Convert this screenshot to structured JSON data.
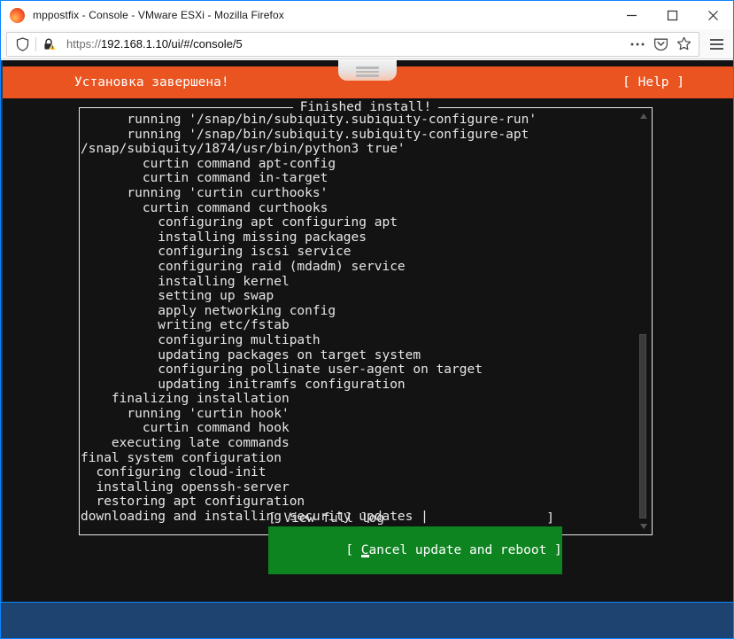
{
  "browser": {
    "window_title": "mppostfix - Console - VMware ESXi - Mozilla Firefox",
    "minimize_label": "Minimize",
    "maximize_label": "Maximize",
    "close_label": "Close",
    "url_scheme": "https://",
    "url_rest": "192.168.1.10/ui/#/console/5",
    "url_full": "https://192.168.1.10/ui/#/console/5",
    "tracking_protection_icon": "shield-icon",
    "site_security_icon": "lock-warning-icon",
    "page_actions_icon": "ellipsis-icon",
    "pocket_icon": "pocket-icon",
    "bookmark_icon": "star-icon",
    "menu_icon": "hamburger-icon",
    "fullscreen_handle_icon": "fullscreen-pulldown-handle"
  },
  "installer": {
    "header_title": "Установка завершена!",
    "help_label": "[ Help ]",
    "accent_color": "#e95420",
    "selected_color": "#0e8420",
    "box_title": "Finished install!",
    "log_lines": [
      "      running '/snap/bin/subiquity.subiquity-configure-run'",
      "      running '/snap/bin/subiquity.subiquity-configure-apt",
      "/snap/subiquity/1874/usr/bin/python3 true'",
      "        curtin command apt-config",
      "        curtin command in-target",
      "      running 'curtin curthooks'",
      "        curtin command curthooks",
      "          configuring apt configuring apt",
      "          installing missing packages",
      "          configuring iscsi service",
      "          configuring raid (mdadm) service",
      "          installing kernel",
      "          setting up swap",
      "          apply networking config",
      "          writing etc/fstab",
      "          configuring multipath",
      "          updating packages on target system",
      "          configuring pollinate user-agent on target",
      "          updating initramfs configuration",
      "    finalizing installation",
      "      running 'curtin hook'",
      "        curtin command hook",
      "    executing late commands",
      "final system configuration",
      "  configuring cloud-init",
      "  installing openssh-server",
      "  restoring apt configuration",
      "downloading and installing security updates |"
    ],
    "scrollbar": {
      "up_arrow_icon": "triangle-up-icon",
      "down_arrow_icon": "triangle-down-icon",
      "thumb_name": "scrollbar-thumb"
    },
    "buttons": [
      {
        "id": "view-full-log",
        "text": "[ View full log                     ]",
        "selected": false
      },
      {
        "id": "cancel-update-and-reboot",
        "prefix": "[ ",
        "cursor_char": "C",
        "suffix": "ancel update and reboot ]",
        "text": "[ Cancel update and reboot ]",
        "selected": true
      }
    ]
  }
}
